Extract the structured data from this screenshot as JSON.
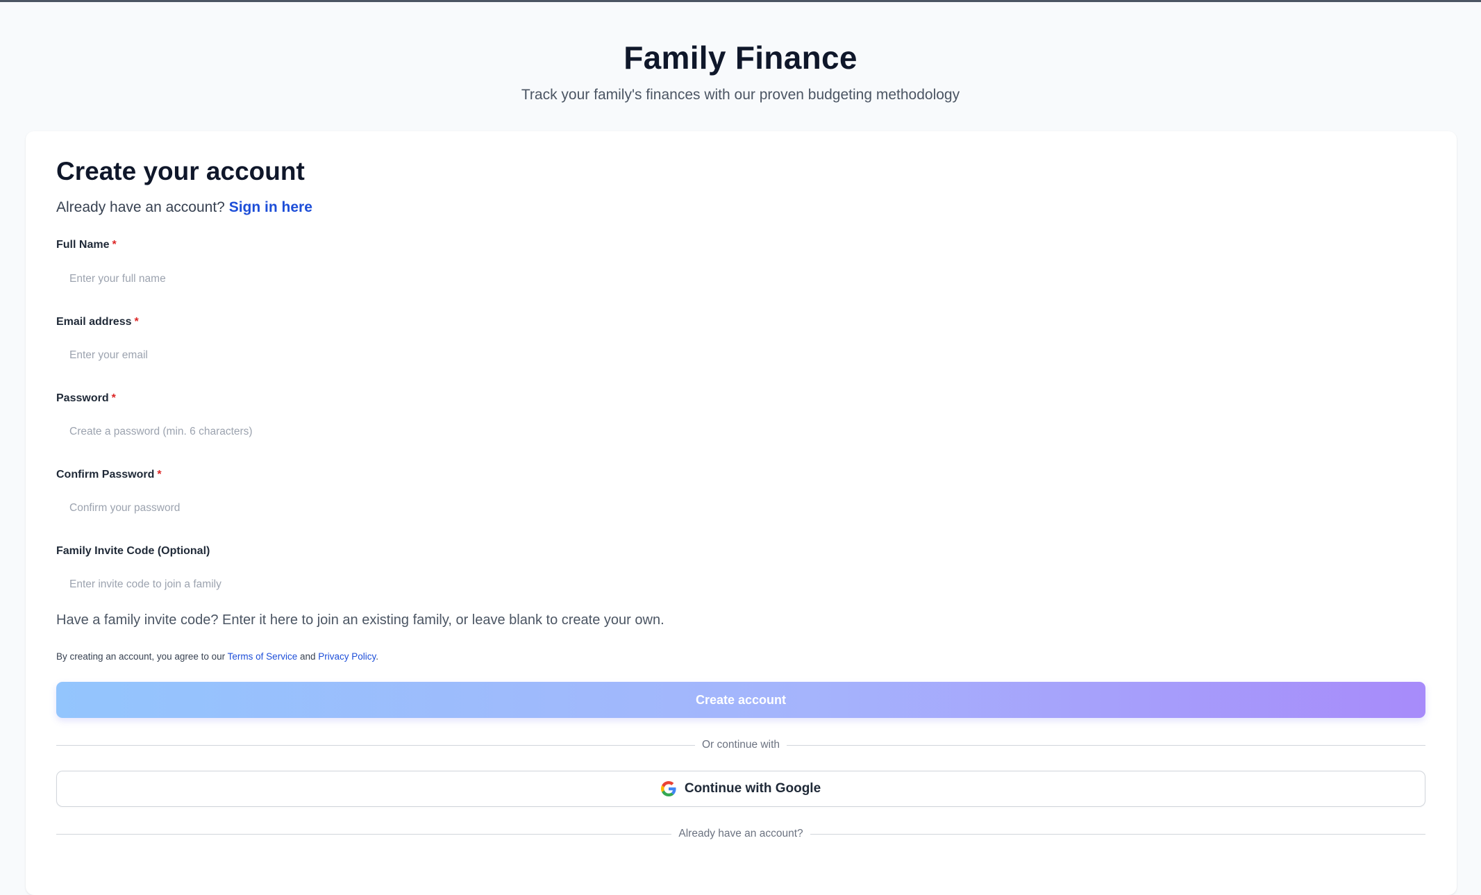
{
  "header": {
    "title": "Family Finance",
    "subtitle": "Track your family's finances with our proven budgeting methodology"
  },
  "form": {
    "title": "Create your account",
    "signin_prompt": "Already have an account?",
    "signin_link": "Sign in here",
    "required_marker": "*",
    "fields": [
      {
        "label": "Full Name",
        "placeholder": "Enter your full name",
        "value": "",
        "required": true
      },
      {
        "label": "Email address",
        "placeholder": "Enter your email",
        "value": "",
        "required": true
      },
      {
        "label": "Password",
        "placeholder": "Create a password (min. 6 characters)",
        "value": "",
        "required": true
      },
      {
        "label": "Confirm Password",
        "placeholder": "Confirm your password",
        "value": "",
        "required": true
      },
      {
        "label": "Family Invite Code (Optional)",
        "placeholder": "Enter invite code to join a family",
        "value": "",
        "required": false
      }
    ],
    "invite_hint": "Have a family invite code? Enter it here to join an existing family, or leave blank to create your own.",
    "terms": {
      "prefix": "By creating an account, you agree to our",
      "tos_link": "Terms of Service",
      "and": "and",
      "privacy_link": "Privacy Policy",
      "suffix": "."
    },
    "submit_label": "Create account",
    "divider_label": "Or continue with",
    "google_label": "Continue with Google",
    "bottom_divider_label": "Already have an account?"
  },
  "colors": {
    "accent": "#1d4ed8",
    "required": "#dc2626",
    "button_gradient_start": "#93c5fd",
    "button_gradient_end": "#a78bfa"
  }
}
